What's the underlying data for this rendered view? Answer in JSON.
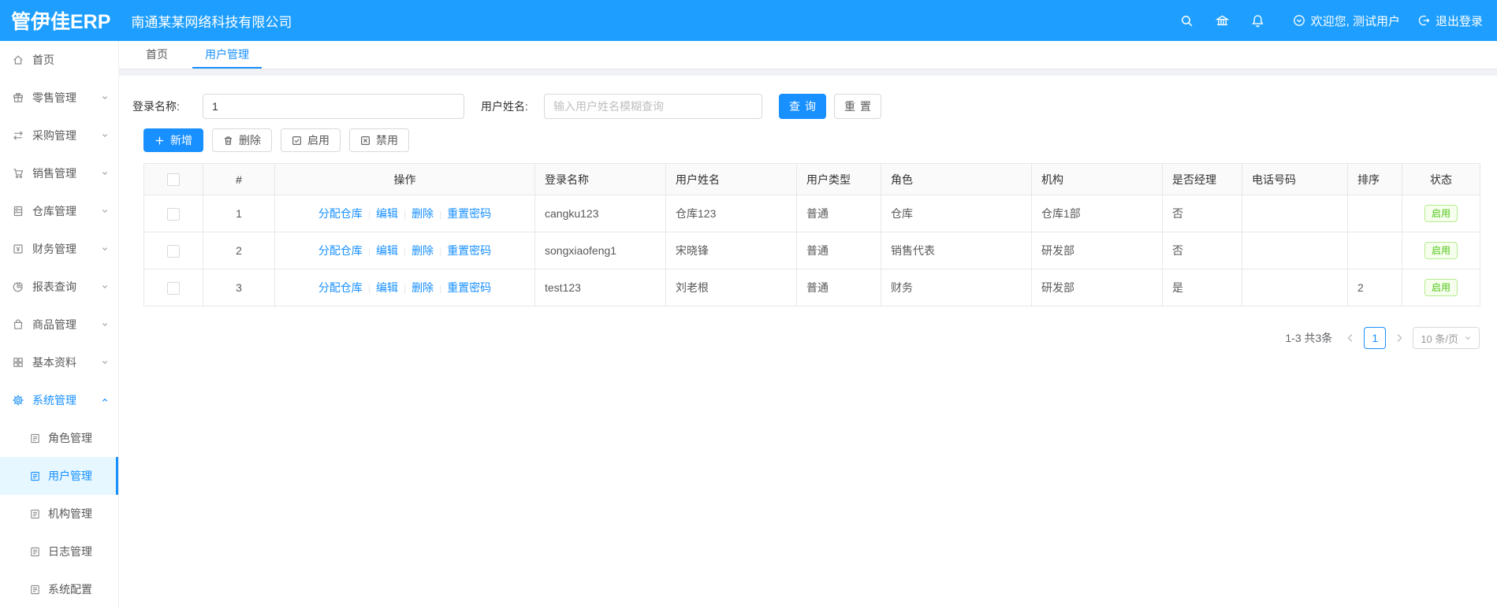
{
  "header": {
    "logo": "管伊佳ERP",
    "company": "南通某某网络科技有限公司",
    "welcome": "欢迎您, 测试用户",
    "logout": "退出登录",
    "icons": [
      "search-icon",
      "bank-icon",
      "bell-icon",
      "down-circle-icon",
      "logout-icon"
    ]
  },
  "sidebar": {
    "items": [
      {
        "label": "首页",
        "icon": "home-icon"
      },
      {
        "label": "零售管理",
        "icon": "gift-icon"
      },
      {
        "label": "采购管理",
        "icon": "swap-icon"
      },
      {
        "label": "销售管理",
        "icon": "cart-icon"
      },
      {
        "label": "仓库管理",
        "icon": "database-icon"
      },
      {
        "label": "财务管理",
        "icon": "finance-icon"
      },
      {
        "label": "报表查询",
        "icon": "pie-chart-icon"
      },
      {
        "label": "商品管理",
        "icon": "shopping-bag-icon"
      },
      {
        "label": "基本资料",
        "icon": "appstore-icon"
      },
      {
        "label": "系统管理",
        "icon": "gear-icon",
        "active": true,
        "expanded": true
      }
    ],
    "submenu": [
      {
        "label": "角色管理",
        "icon": "doc-icon"
      },
      {
        "label": "用户管理",
        "icon": "doc-icon",
        "active": true
      },
      {
        "label": "机构管理",
        "icon": "doc-icon"
      },
      {
        "label": "日志管理",
        "icon": "doc-icon"
      },
      {
        "label": "系统配置",
        "icon": "doc-icon"
      }
    ]
  },
  "tabs": [
    {
      "label": "首页"
    },
    {
      "label": "用户管理",
      "active": true
    }
  ],
  "form": {
    "login_label": "登录名称:",
    "login_value": "1",
    "name_label": "用户姓名:",
    "name_placeholder": "输入用户姓名模糊查询",
    "search_button": "查询",
    "reset_button": "重置"
  },
  "toolbar": {
    "add": "新增",
    "delete": "删除",
    "enable": "启用",
    "disable": "禁用"
  },
  "table": {
    "headers": [
      "#",
      "操作",
      "登录名称",
      "用户姓名",
      "用户类型",
      "角色",
      "机构",
      "是否经理",
      "电话号码",
      "排序",
      "状态"
    ],
    "rows": [
      {
        "num": "1",
        "ops": [
          "分配仓库",
          "编辑",
          "删除",
          "重置密码"
        ],
        "login_name": "cangku123",
        "user_name": "仓库123",
        "user_type": "普通",
        "role": "仓库",
        "org": "仓库1部",
        "is_manager": "否",
        "phone": "",
        "sort": "",
        "status": "启用"
      },
      {
        "num": "2",
        "ops": [
          "分配仓库",
          "编辑",
          "删除",
          "重置密码"
        ],
        "login_name": "songxiaofeng1",
        "user_name": "宋晓锋",
        "user_type": "普通",
        "role": "销售代表",
        "org": "研发部",
        "is_manager": "否",
        "phone": "",
        "sort": "",
        "status": "启用"
      },
      {
        "num": "3",
        "ops": [
          "分配仓库",
          "编辑",
          "删除",
          "重置密码"
        ],
        "login_name": "test123",
        "user_name": "刘老根",
        "user_type": "普通",
        "role": "财务",
        "org": "研发部",
        "is_manager": "是",
        "phone": "",
        "sort": "2",
        "status": "启用"
      }
    ]
  },
  "pagination": {
    "summary": "1-3 共3条",
    "current_page": "1",
    "page_size": "10 条/页"
  },
  "colors": {
    "primary": "#1890ff",
    "header_bg": "#1e9fff",
    "active_item_bg": "#e6f7ff",
    "tag_green_text": "#52c41a",
    "tag_green_border": "#b7eb8f",
    "tag_green_bg": "#f6ffed",
    "table_border": "#e8e8e8"
  }
}
